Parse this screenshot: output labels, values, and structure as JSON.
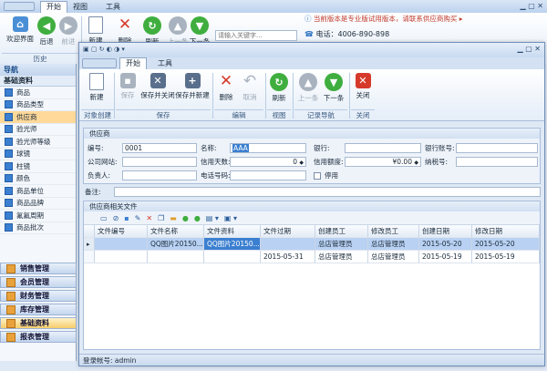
{
  "outer": {
    "tabs": [
      "开始",
      "视图",
      "工具"
    ],
    "buttons": [
      "欢迎界面",
      "后退",
      "前进",
      "新建",
      "删除",
      "刷新",
      "上一条",
      "下一条"
    ],
    "group_history": "历史",
    "search_placeholder": "请输入关键字...",
    "notice": "当前版本是专业版试用版本，请联系供应商购买",
    "phone_label": "电话：",
    "phone": "4006-890-898"
  },
  "nav": {
    "header": "导航",
    "section": "基础资料",
    "items": [
      "商品",
      "商品类型",
      "供应商",
      "验光师",
      "验光师等级",
      "球镜",
      "柱镜",
      "颜色",
      "商品单位",
      "商品品牌",
      "氟氟周期",
      "商品批次"
    ],
    "groups": [
      "销售管理",
      "会员管理",
      "财务管理",
      "库存管理",
      "基础资料",
      "报表管理"
    ]
  },
  "inner": {
    "tabs": [
      "开始",
      "工具"
    ],
    "buttons": [
      "新建",
      "保存",
      "保存并关闭",
      "保存并新建",
      "删除",
      "取消",
      "刷新",
      "上一条",
      "下一条",
      "关闭"
    ],
    "groups": [
      "对象创建",
      "保存",
      "编辑",
      "视图",
      "记录导航",
      "关闭"
    ]
  },
  "form": {
    "section": "供应商",
    "fields": {
      "code_label": "编号:",
      "code": "0001",
      "name_label": "名称:",
      "name": "AAA",
      "bank_label": "银行:",
      "bank": "",
      "account_label": "银行账号:",
      "account": "",
      "site_label": "公司网站:",
      "site": "",
      "credit_days_label": "信用天数:",
      "credit_days": "0",
      "credit_amt_label": "信用额度:",
      "credit_amt": "¥0.00",
      "tax_label": "纳税号:",
      "tax": "",
      "owner_label": "负责人:",
      "owner": "",
      "phone_label": "电话号码:",
      "phone": "",
      "disable_label": "停用",
      "remark_label": "备注:",
      "remark": ""
    }
  },
  "files": {
    "section": "供应商相关文件",
    "headers": [
      "文件编号",
      "文件名称",
      "文件资料",
      "文件过期",
      "创建员工",
      "修改员工",
      "创建日期",
      "修改日期"
    ],
    "rows": [
      [
        "",
        "QQ图片20150...",
        "QQ图片20150...",
        "",
        "总店管理员",
        "总店管理员",
        "2015-05-20",
        "2015-05-20"
      ],
      [
        "",
        "",
        "",
        "2015-05-31",
        "总店管理员",
        "总店管理员",
        "2015-05-19",
        "2015-05-19"
      ]
    ]
  },
  "status": {
    "text": "登录帐号: admin"
  },
  "colors": {
    "accent": "#3b7fd0",
    "nav_selected": "#ffd99a",
    "row_selected": "#b9d1f2",
    "close_red": "#d63a2b",
    "new_green": "#3fae3f"
  }
}
